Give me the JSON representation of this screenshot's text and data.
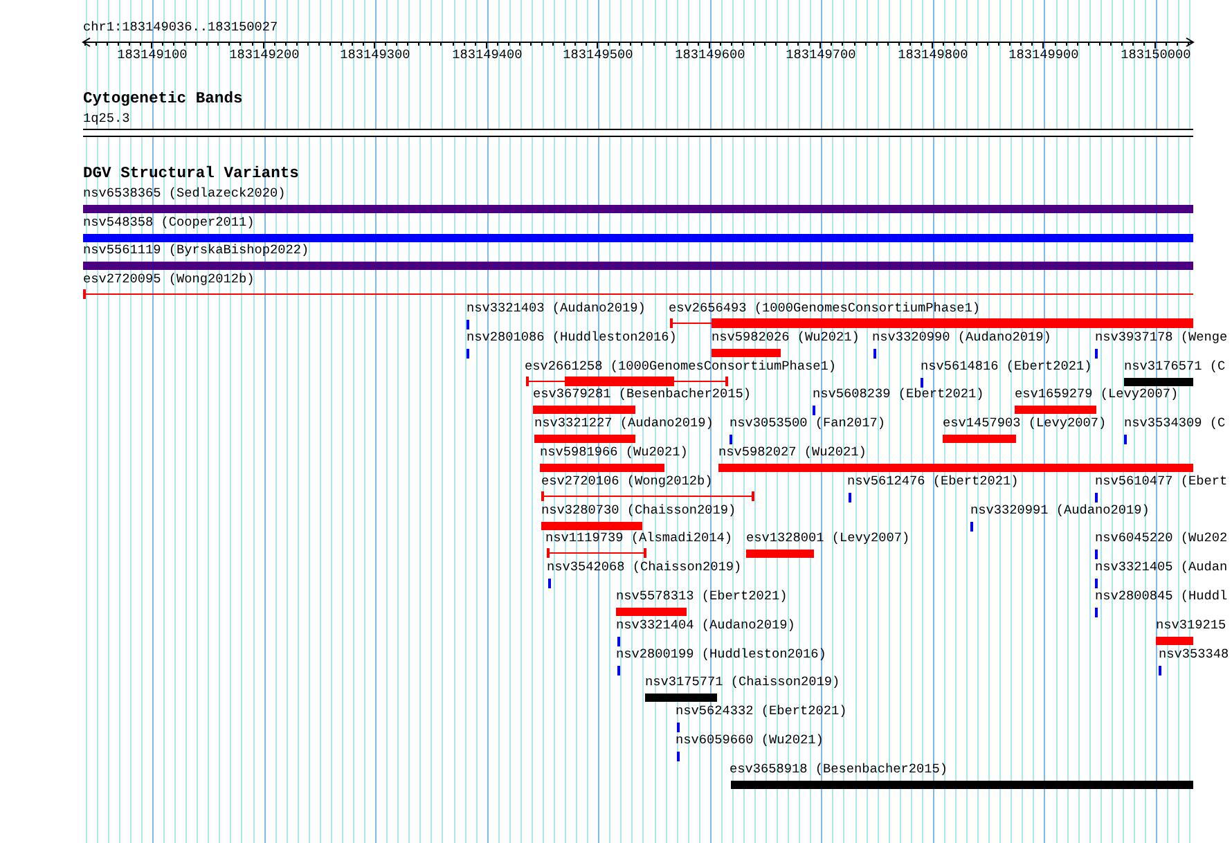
{
  "ruler": {
    "location": "chr1:183149036..183150027",
    "ticks": [
      "183149100",
      "183149200",
      "183149300",
      "183149400",
      "183149500",
      "183149600",
      "183149700",
      "183149800",
      "183149900",
      "183150000"
    ]
  },
  "cytogenetic_bands": {
    "title": "Cytogenetic Bands",
    "band": "1q25.3"
  },
  "structural_variants": {
    "title": "DGV Structural Variants",
    "features": [
      {
        "label": "nsv6538365 (Sedlazeck2020)",
        "kind": "bar",
        "color": "#4b0082"
      },
      {
        "label": "nsv548358 (Cooper2011)",
        "kind": "bar",
        "color": "#0000ff"
      },
      {
        "label": "nsv5561119 (ByrskaBishop2022)",
        "kind": "bar",
        "color": "#4b0082"
      },
      {
        "label": "esv2720095 (Wong2012b)",
        "kind": "span",
        "color": "#ff0000"
      },
      {
        "label": "nsv3321403 (Audano2019)",
        "kind": "point",
        "color": "#0000ff"
      },
      {
        "label": "esv2656493 (1000GenomesConsortiumPhase1)",
        "kind": "span",
        "color": "#ff0000"
      },
      {
        "label": "nsv2801086 (Huddleston2016)",
        "kind": "point",
        "color": "#0000ff"
      },
      {
        "label": "nsv5982026 (Wu2021)",
        "kind": "bar",
        "color": "#ff0000"
      },
      {
        "label": "nsv3320990 (Audano2019)",
        "kind": "point",
        "color": "#0000ff"
      },
      {
        "label": "nsv3937178 (Wenge",
        "kind": "point",
        "color": "#0000ff"
      },
      {
        "label": "esv2661258 (1000GenomesConsortiumPhase1)",
        "kind": "span",
        "color": "#ff0000"
      },
      {
        "label": "nsv5614816 (Ebert2021)",
        "kind": "point",
        "color": "#0000ff"
      },
      {
        "label": "nsv3176571 (C",
        "kind": "bar",
        "color": "#000000"
      },
      {
        "label": "esv3679281 (Besenbacher2015)",
        "kind": "bar",
        "color": "#ff0000"
      },
      {
        "label": "nsv5608239 (Ebert2021)",
        "kind": "point",
        "color": "#0000ff"
      },
      {
        "label": "esv1659279 (Levy2007)",
        "kind": "bar",
        "color": "#ff0000"
      },
      {
        "label": "nsv3321227 (Audano2019)",
        "kind": "bar",
        "color": "#ff0000"
      },
      {
        "label": "nsv3053500 (Fan2017)",
        "kind": "point",
        "color": "#0000ff"
      },
      {
        "label": "esv1457903 (Levy2007)",
        "kind": "bar",
        "color": "#ff0000"
      },
      {
        "label": "nsv3534309 (C",
        "kind": "point",
        "color": "#0000ff"
      },
      {
        "label": "nsv5981966 (Wu2021)",
        "kind": "bar",
        "color": "#ff0000"
      },
      {
        "label": "nsv5982027 (Wu2021)",
        "kind": "bar",
        "color": "#ff0000"
      },
      {
        "label": "esv2720106 (Wong2012b)",
        "kind": "span",
        "color": "#ff0000"
      },
      {
        "label": "nsv5612476 (Ebert2021)",
        "kind": "point",
        "color": "#0000ff"
      },
      {
        "label": "nsv5610477 (Ebert",
        "kind": "point",
        "color": "#0000ff"
      },
      {
        "label": "nsv3280730 (Chaisson2019)",
        "kind": "bar",
        "color": "#ff0000"
      },
      {
        "label": "nsv3320991 (Audano2019)",
        "kind": "point",
        "color": "#0000ff"
      },
      {
        "label": "nsv1119739 (Alsmadi2014)",
        "kind": "span",
        "color": "#ff0000"
      },
      {
        "label": "esv1328001 (Levy2007)",
        "kind": "bar",
        "color": "#ff0000"
      },
      {
        "label": "nsv6045220 (Wu202",
        "kind": "point",
        "color": "#0000ff"
      },
      {
        "label": "nsv3542068 (Chaisson2019)",
        "kind": "point",
        "color": "#0000ff"
      },
      {
        "label": "nsv3321405 (Audan",
        "kind": "point",
        "color": "#0000ff"
      },
      {
        "label": "nsv5578313 (Ebert2021)",
        "kind": "bar",
        "color": "#ff0000"
      },
      {
        "label": "nsv2800845 (Huddl",
        "kind": "point",
        "color": "#0000ff"
      },
      {
        "label": "nsv3321404 (Audano2019)",
        "kind": "point",
        "color": "#0000ff"
      },
      {
        "label": "nsv319215",
        "kind": "bar",
        "color": "#ff0000"
      },
      {
        "label": "nsv2800199 (Huddleston2016)",
        "kind": "point",
        "color": "#0000ff"
      },
      {
        "label": "nsv353348",
        "kind": "point",
        "color": "#0000ff"
      },
      {
        "label": "nsv3175771 (Chaisson2019)",
        "kind": "bar",
        "color": "#000000"
      },
      {
        "label": "nsv5624332 (Ebert2021)",
        "kind": "point",
        "color": "#0000ff"
      },
      {
        "label": "nsv6059660 (Wu2021)",
        "kind": "point",
        "color": "#0000ff"
      },
      {
        "label": "esv3658918 (Besenbacher2015)",
        "kind": "bar",
        "color": "#000000"
      }
    ]
  }
}
